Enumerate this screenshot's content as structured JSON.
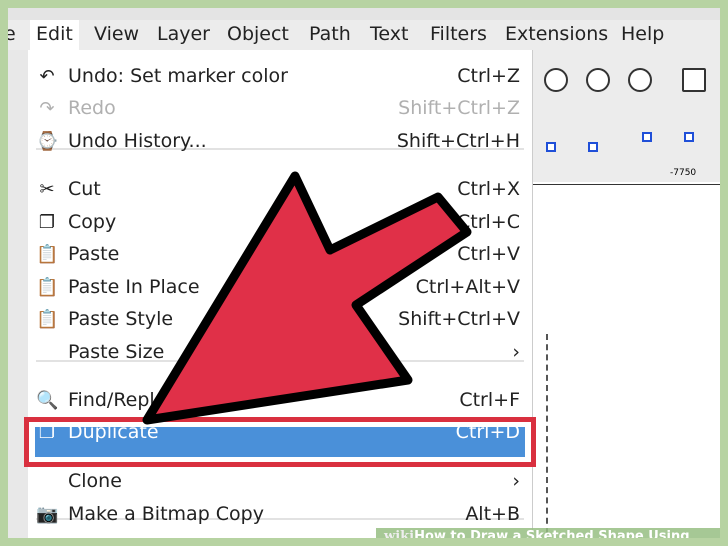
{
  "menubar": {
    "items": [
      "e",
      "Edit",
      "View",
      "Layer",
      "Object",
      "Path",
      "Text",
      "Filters",
      "Extensions",
      "Help"
    ]
  },
  "menu": {
    "items": [
      {
        "icon": "undo-icon",
        "label": "Undo: Set marker color",
        "shortcut": "Ctrl+Z"
      },
      {
        "icon": "redo-icon",
        "label": "Redo",
        "shortcut": "Shift+Ctrl+Z",
        "disabled": true
      },
      {
        "icon": "undo-history-icon",
        "label": "Undo History...",
        "shortcut": "Shift+Ctrl+H"
      },
      {
        "icon": "cut-icon",
        "label": "Cut",
        "shortcut": "Ctrl+X"
      },
      {
        "icon": "copy-icon",
        "label": "Copy",
        "shortcut": "Ctrl+C"
      },
      {
        "icon": "paste-icon",
        "label": "Paste",
        "shortcut": "Ctrl+V"
      },
      {
        "icon": "paste-in-place-icon",
        "label": "Paste In Place",
        "shortcut": "Ctrl+Alt+V"
      },
      {
        "icon": "paste-style-icon",
        "label": "Paste Style",
        "shortcut": "Shift+Ctrl+V"
      },
      {
        "icon": "",
        "label": "Paste Size",
        "shortcut": "›"
      },
      {
        "icon": "find-icon",
        "label": "Find/Repla",
        "shortcut": "Ctrl+F"
      },
      {
        "icon": "duplicate-icon",
        "label": "Duplicate",
        "shortcut": "Ctrl+D",
        "highlighted": true
      },
      {
        "icon": "",
        "label": "Clone",
        "shortcut": "›"
      },
      {
        "icon": "bitmap-copy-icon",
        "label": "Make a Bitmap Copy",
        "shortcut": "Alt+B"
      }
    ]
  },
  "ruler": {
    "label": "-7750"
  },
  "watermark": {
    "prefix": "wiki",
    "text": "How to Draw a Sketched Shape Using Inkscape"
  },
  "colors": {
    "highlight": "#4a90d9",
    "annotation": "#d9303f",
    "arrow": "#e03048",
    "frame": "#b7d3a2"
  }
}
